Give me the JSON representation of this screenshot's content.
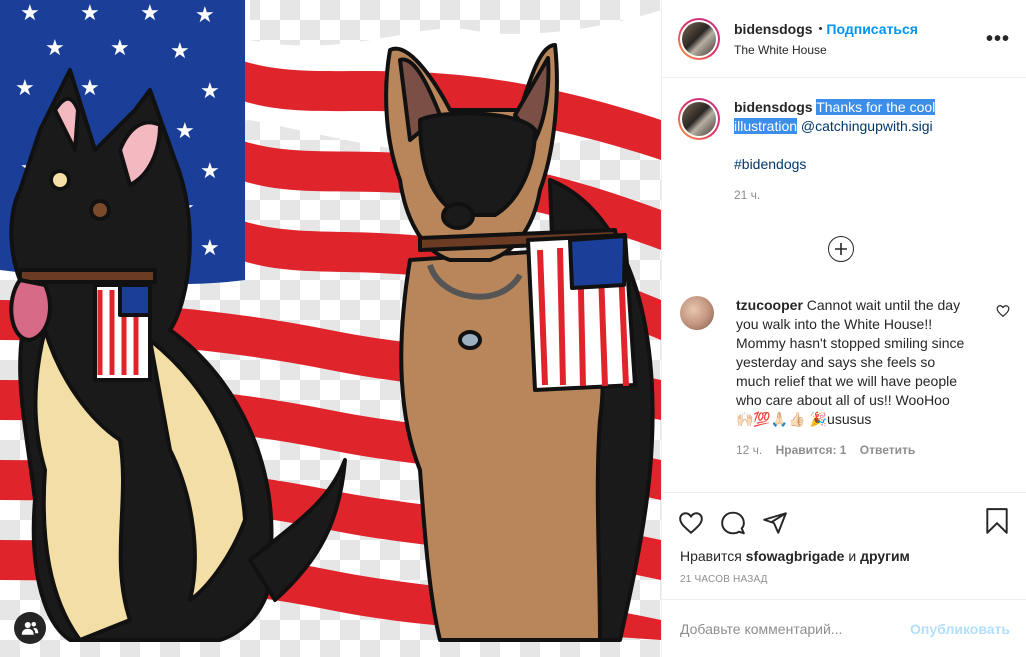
{
  "post": {
    "author": "bidensdogs",
    "follow_label": "Подписаться",
    "location": "The White House",
    "more_label": "•••"
  },
  "caption": {
    "username": "bidensdogs",
    "highlighted": "Thanks for the cool illustration",
    "mention": "@catchingupwith.sigi",
    "hashtag": "#bidendogs",
    "time": "21 ч."
  },
  "comment": {
    "username": "tzucooper",
    "text": "Cannot wait until the day you walk into the White House!! Mommy hasn't stopped smiling since yesterday and says she feels so much relief that we will have people who care about all of us!! WooHoo 🙌🏻💯🙏🏻👍🏻 🎉ususus",
    "time": "12 ч.",
    "likes": "Нравится: 1",
    "reply": "Ответить"
  },
  "likes": {
    "prefix": "Нравится",
    "user": "sfowagbrigade",
    "joiner": "и",
    "others": "другим"
  },
  "posted_ago": "21 ЧАСОВ НАЗАД",
  "add_comment": {
    "placeholder": "Добавьте комментарий...",
    "publish": "Опубликовать"
  },
  "colors": {
    "accent": "#0095f6",
    "highlight": "#3b8eea",
    "flag_red": "#e0242b",
    "flag_blue": "#1b3f99"
  },
  "icons": [
    "heart-icon",
    "comment-icon",
    "share-icon",
    "bookmark-icon",
    "plus-circle-icon",
    "more-icon",
    "tagged-users-icon"
  ]
}
